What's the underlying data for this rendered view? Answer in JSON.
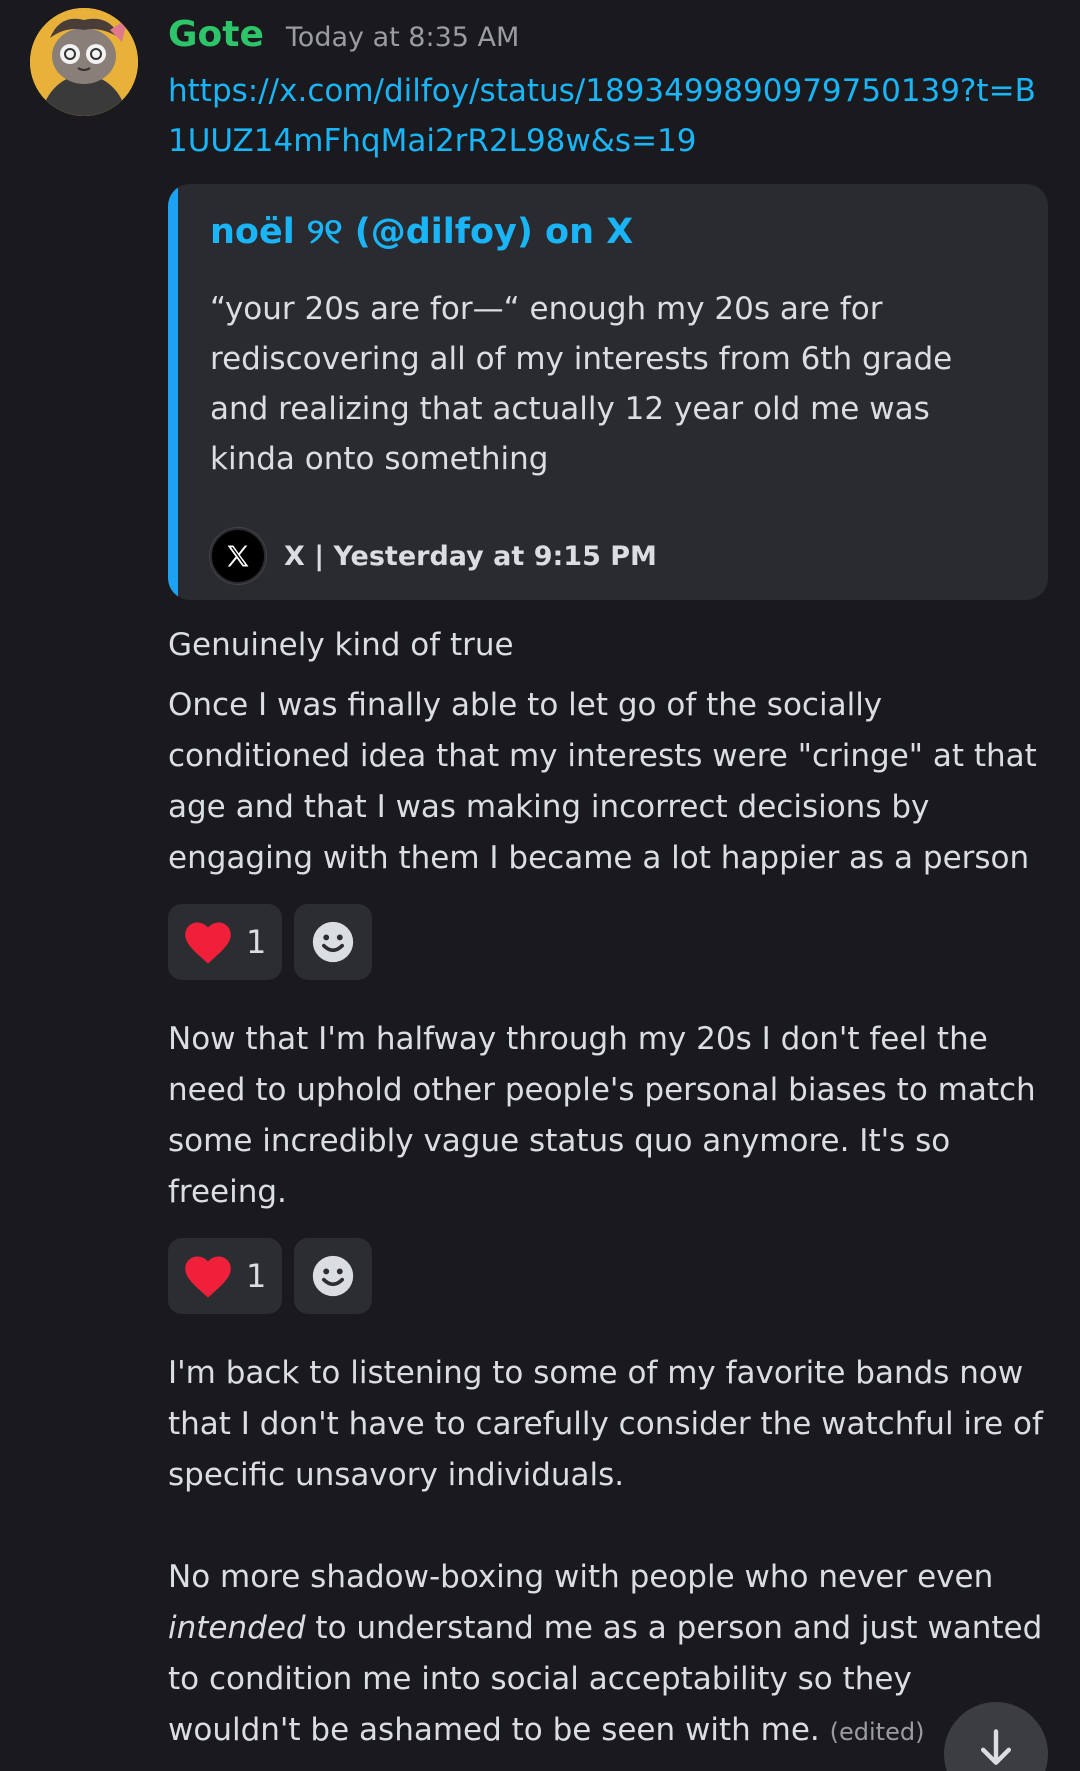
{
  "message": {
    "username": "Gote",
    "timestamp": "Today at 8:35 AM",
    "link": "https://x.com/dilfoy/status/1893499890979750139?t=B1UUZ14mFhqMai2rR2L98w&s=19",
    "embed": {
      "author": "noël ୨୧ (@dilfoy) on X",
      "text": "“your 20s are for—“ enough my 20s are for rediscovering all of my interests from 6th grade and realizing that actually 12 year old me was kinda onto something",
      "footer": "X | Yesterday at 9:15 PM"
    },
    "paragraphs": {
      "p1": "Genuinely kind of true",
      "p2": "Once I was finally able to let go of the socially conditioned idea that my interests were \"cringe\" at that age and that I was making incorrect decisions by engaging with them I became a lot happier as a person",
      "p3": "Now that I'm halfway through my 20s I don't feel the need to uphold other people's personal biases to match some incredibly vague status quo anymore. It's so freeing.",
      "p4": "I'm back to listening to some of my favorite bands now that I don't have to carefully consider the watchful ire of specific unsavory individuals.",
      "p5_before": "No more shadow-boxing with people who never even ",
      "p5_italic": "intended",
      "p5_after": " to understand me as a person and just wanted to condition me into social acceptability so they wouldn't be ashamed to be seen with me. ",
      "edited": "(edited)"
    },
    "reactions": [
      {
        "emoji": "heart-icon",
        "count": "1"
      },
      {
        "emoji": "heart-icon",
        "count": "1"
      }
    ]
  },
  "colors": {
    "background": "#1a1a1e",
    "username": "#2dc46a",
    "link": "#19b5f7",
    "embed_bar": "#1da1f2",
    "heart": "#f0203a"
  }
}
